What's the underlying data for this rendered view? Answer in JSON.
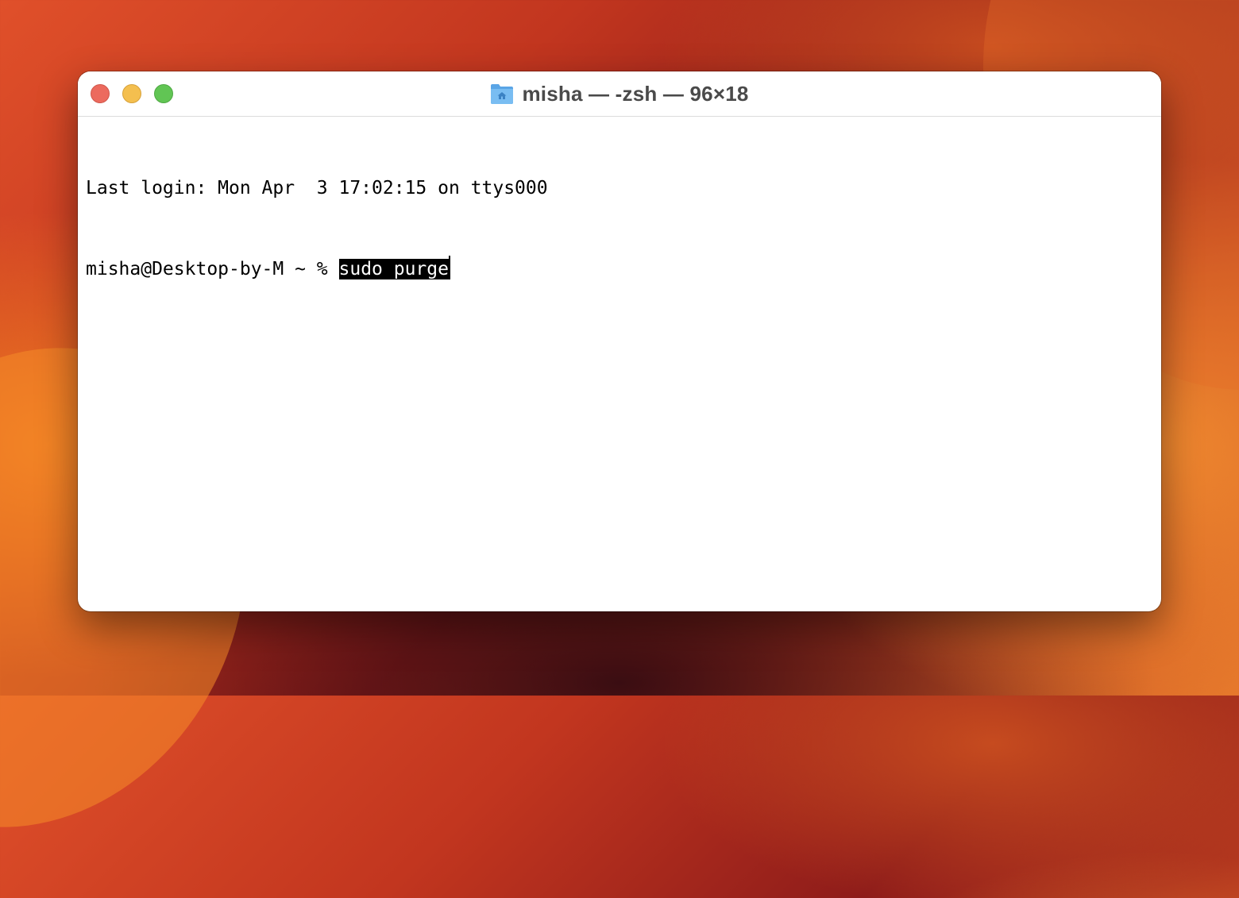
{
  "window": {
    "title": "misha — -zsh — 96×18",
    "icon": "home-folder-icon"
  },
  "terminal": {
    "lines": [
      "Last login: Mon Apr  3 17:02:15 on ttys000"
    ],
    "prompt": "misha@Desktop-by-M ~ % ",
    "command": "sudo purge"
  },
  "colors": {
    "close": "#ec6a5e",
    "minimize": "#f4bf4f",
    "maximize": "#61c554",
    "selection_bg": "#000000",
    "selection_fg": "#ffffff"
  }
}
